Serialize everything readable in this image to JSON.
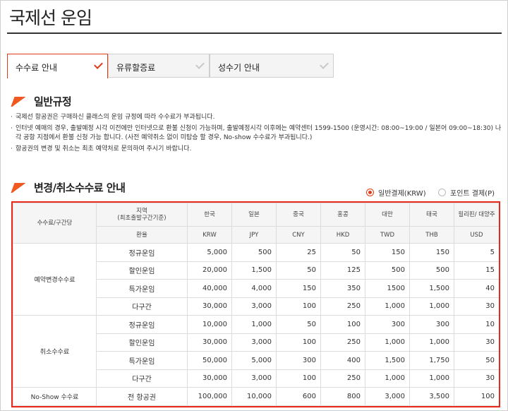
{
  "page": {
    "title": "국제선 운임"
  },
  "tabs": [
    {
      "label": "수수료 안내",
      "active": true
    },
    {
      "label": "유류할증료",
      "active": false
    },
    {
      "label": "성수기 안내",
      "active": false
    }
  ],
  "general": {
    "title": "일반규정",
    "rules": [
      "국제선 항공권은 구매하신 클래스의 운임 규정에 따라 수수료가 부과됩니다.",
      "인터넷 예매의 경우, 출발예정 시각 이전에만 인터넷으로 환불 신청이 가능하며, 출발예정시각 이후에는 예약센터 1599-1500 (운영시간: 08:00~19:00 / 일본어 09:00~18:30) 나 각 공항 지점에서 환불 신청 가능 합니다. (사전 예약취소 없이 미탑승 할 경우, No-show 수수료가 부과됩니다.)",
      "항공권의 변경 및 취소는 최초 예약처로 문의하여 주시기 바랍니다."
    ]
  },
  "fees": {
    "title": "변경/취소수수료 안내",
    "radio": {
      "general": "일반결제(KRW)",
      "points": "포인트 결제(P)",
      "selected": "general"
    },
    "header": {
      "fee_col": "수수료/구간당",
      "region_label_1": "지역",
      "region_label_2": "(최초출발구간기준)",
      "currency_label": "환율",
      "regions": [
        "한국",
        "일본",
        "중국",
        "홍콩",
        "대만",
        "태국",
        "필리핀/ 대양주"
      ],
      "currencies": [
        "KRW",
        "JPY",
        "CNY",
        "HKD",
        "TWD",
        "THB",
        "USD"
      ]
    },
    "groups": [
      {
        "name": "예약변경수수료",
        "rows": [
          {
            "fare": "정규운임",
            "values": [
              "5,000",
              "500",
              "25",
              "50",
              "150",
              "150",
              "5"
            ]
          },
          {
            "fare": "할인운임",
            "values": [
              "20,000",
              "1,500",
              "50",
              "125",
              "500",
              "500",
              "15"
            ]
          },
          {
            "fare": "특가운임",
            "values": [
              "40,000",
              "4,000",
              "150",
              "350",
              "1500",
              "1,500",
              "40"
            ]
          },
          {
            "fare": "다구간",
            "values": [
              "30,000",
              "3,000",
              "100",
              "250",
              "1,000",
              "1,000",
              "30"
            ]
          }
        ]
      },
      {
        "name": "취소수수료",
        "rows": [
          {
            "fare": "정규운임",
            "values": [
              "10,000",
              "1,000",
              "50",
              "100",
              "300",
              "300",
              "10"
            ]
          },
          {
            "fare": "할인운임",
            "values": [
              "30,000",
              "3,000",
              "100",
              "250",
              "1,000",
              "1,000",
              "30"
            ]
          },
          {
            "fare": "특가운임",
            "values": [
              "50,000",
              "5,000",
              "300",
              "400",
              "1,500",
              "1,750",
              "50"
            ]
          },
          {
            "fare": "다구간",
            "values": [
              "30,000",
              "3,000",
              "100",
              "250",
              "1,000",
              "1,000",
              "30"
            ]
          }
        ]
      },
      {
        "name": "No-Show 수수료",
        "rows": [
          {
            "fare": "전 항공권",
            "values": [
              "100,000",
              "10,000",
              "600",
              "800",
              "3,000",
              "3,500",
              "100"
            ]
          }
        ]
      }
    ]
  },
  "colors": {
    "accent": "#e03b16",
    "table_border": "#e8281c",
    "header_bg": "#f5f5f5"
  }
}
